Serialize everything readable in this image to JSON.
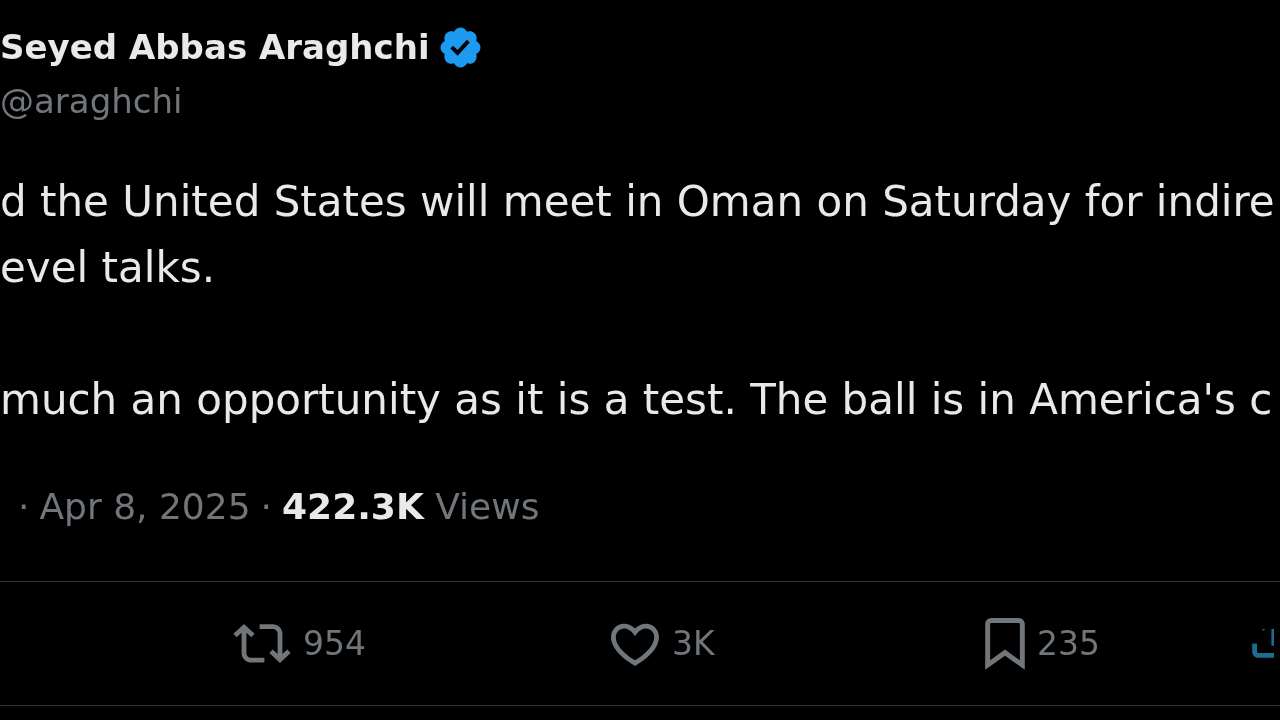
{
  "tweet": {
    "author": {
      "name": "Seyed Abbas Araghchi",
      "verified": true,
      "handle": "@araghchi"
    },
    "paragraphs": [
      [
        "d the United States will meet in Oman on Saturday for indire",
        "evel talks."
      ],
      [
        "much an opportunity as it is a test. The ball is in America's c"
      ]
    ],
    "meta": {
      "leading_separator": "·",
      "date": "Apr 8, 2025",
      "separator": "·",
      "views": "**422.3K** Views"
    },
    "actions": [
      {
        "kind": "retweet",
        "count": "954"
      },
      {
        "kind": "like",
        "count": "3K"
      },
      {
        "kind": "bookmark",
        "count": "235"
      },
      {
        "kind": "share"
      }
    ]
  }
}
